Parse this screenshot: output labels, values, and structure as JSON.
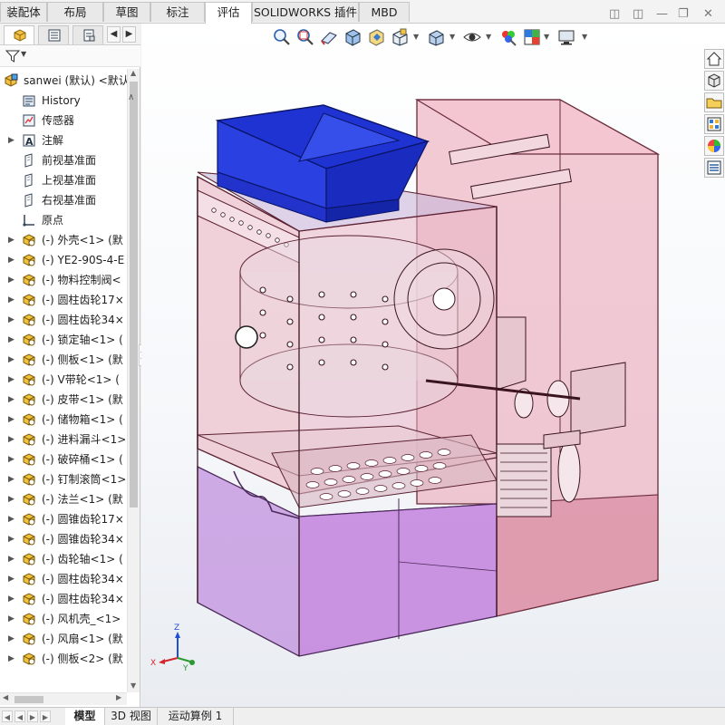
{
  "command_tabs": [
    "装配体",
    "布局",
    "草图",
    "标注",
    "评估",
    "SOLIDWORKS 插件",
    "MBD"
  ],
  "active_tab": "评估",
  "tree": {
    "root_label": "sanwei (默认) <默认",
    "items": [
      {
        "label": "History",
        "icon": "history-icon",
        "expandable": false
      },
      {
        "label": "传感器",
        "icon": "sensor-icon",
        "expandable": false
      },
      {
        "label": "注解",
        "icon": "annotation-icon",
        "expandable": true
      },
      {
        "label": "前视基准面",
        "icon": "plane-icon",
        "expandable": false
      },
      {
        "label": "上视基准面",
        "icon": "plane-icon",
        "expandable": false
      },
      {
        "label": "右视基准面",
        "icon": "plane-icon",
        "expandable": false
      },
      {
        "label": "原点",
        "icon": "origin-icon",
        "expandable": false
      },
      {
        "label": "(-) 外壳<1> (默",
        "icon": "part-icon",
        "expandable": true
      },
      {
        "label": "(-) YE2-90S-4-E",
        "icon": "part-icon",
        "expandable": true
      },
      {
        "label": "(-) 物料控制阀<",
        "icon": "part-icon",
        "expandable": true
      },
      {
        "label": "(-) 圆柱齿轮17×",
        "icon": "part-icon",
        "expandable": true
      },
      {
        "label": "(-) 圆柱齿轮34×",
        "icon": "part-icon",
        "expandable": true
      },
      {
        "label": "(-) 锁定轴<1> (",
        "icon": "part-icon",
        "expandable": true
      },
      {
        "label": "(-) 侧板<1> (默",
        "icon": "part-icon",
        "expandable": true
      },
      {
        "label": "(-) V带轮<1> (",
        "icon": "part-icon",
        "expandable": true
      },
      {
        "label": "(-) 皮带<1> (默",
        "icon": "part-icon",
        "expandable": true
      },
      {
        "label": "(-) 储物箱<1> (",
        "icon": "part-icon",
        "expandable": true
      },
      {
        "label": "(-) 进料漏斗<1>",
        "icon": "part-icon",
        "expandable": true
      },
      {
        "label": "(-) 破碎桶<1> (",
        "icon": "part-icon",
        "expandable": true
      },
      {
        "label": "(-) 钉制滚筒<1>",
        "icon": "part-icon",
        "expandable": true
      },
      {
        "label": "(-) 法兰<1> (默",
        "icon": "part-icon",
        "expandable": true
      },
      {
        "label": "(-) 圆锥齿轮17×",
        "icon": "part-icon",
        "expandable": true
      },
      {
        "label": "(-) 圆锥齿轮34×",
        "icon": "part-icon",
        "expandable": true
      },
      {
        "label": "(-) 齿轮轴<1> (",
        "icon": "part-icon",
        "expandable": true
      },
      {
        "label": "(-) 圆柱齿轮34×",
        "icon": "part-icon",
        "expandable": true
      },
      {
        "label": "(-) 圆柱齿轮34×",
        "icon": "part-icon",
        "expandable": true
      },
      {
        "label": "(-) 风机壳_<1>",
        "icon": "part-icon",
        "expandable": true
      },
      {
        "label": "(-) 风扇<1> (默",
        "icon": "part-icon",
        "expandable": true
      },
      {
        "label": "(-) 侧板<2> (默",
        "icon": "part-icon",
        "expandable": true
      }
    ]
  },
  "bottom_tabs": [
    "模型",
    "3D 视图",
    "运动算例 1"
  ],
  "active_bottom_tab": "模型",
  "triad": {
    "x": "X",
    "y": "Y",
    "z": "Z"
  },
  "hud_icons": [
    "zoom-to-fit-icon",
    "zoom-area-icon",
    "previous-view-icon",
    "section-view-icon",
    "dynamic-annotation-icon",
    "view-orientation-icon",
    "display-style-icon",
    "hide-show-icon",
    "edit-appearance-icon",
    "apply-scene-icon",
    "view-settings-icon"
  ],
  "task_pane_icons": [
    "home-icon",
    "design-library-icon",
    "file-explorer-icon",
    "view-palette-icon",
    "appearances-icon",
    "custom-properties-icon"
  ],
  "colors": {
    "hopper_blue": "#2036d6",
    "shell_pink": "#e89aab",
    "lower_purple": "#b87ad6",
    "accent": "#1c6fc9"
  }
}
